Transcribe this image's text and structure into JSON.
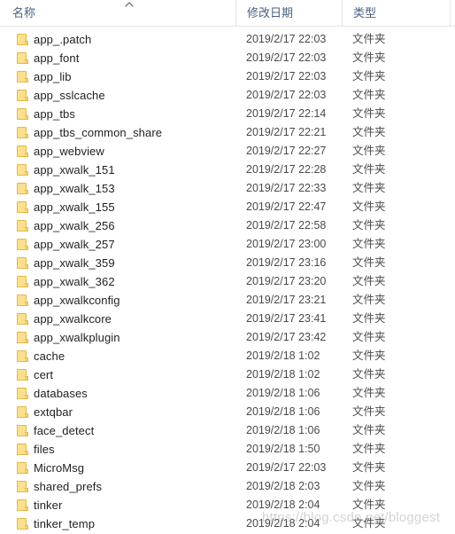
{
  "header": {
    "columns": [
      {
        "label": "名称",
        "name": "column-header-name"
      },
      {
        "label": "修改日期",
        "name": "column-header-date-modified"
      },
      {
        "label": "类型",
        "name": "column-header-type"
      }
    ],
    "sort_indicator": "chevron-up-icon"
  },
  "colors": {
    "header_text": "#4a6180",
    "row_text": "#1f1f1f",
    "meta_text": "#4a4a4a",
    "folder_fill": "#fbe08d",
    "folder_border": "#e3b94a",
    "divider": "#e3e3e3"
  },
  "rows": [
    {
      "icon": "folder-icon",
      "name": "app_.patch",
      "date": "2019/2/17 22:03",
      "type": "文件夹"
    },
    {
      "icon": "folder-icon",
      "name": "app_font",
      "date": "2019/2/17 22:03",
      "type": "文件夹"
    },
    {
      "icon": "folder-icon",
      "name": "app_lib",
      "date": "2019/2/17 22:03",
      "type": "文件夹"
    },
    {
      "icon": "folder-icon",
      "name": "app_sslcache",
      "date": "2019/2/17 22:03",
      "type": "文件夹"
    },
    {
      "icon": "folder-icon",
      "name": "app_tbs",
      "date": "2019/2/17 22:14",
      "type": "文件夹"
    },
    {
      "icon": "folder-icon",
      "name": "app_tbs_common_share",
      "date": "2019/2/17 22:21",
      "type": "文件夹"
    },
    {
      "icon": "folder-icon",
      "name": "app_webview",
      "date": "2019/2/17 22:27",
      "type": "文件夹"
    },
    {
      "icon": "folder-icon",
      "name": "app_xwalk_151",
      "date": "2019/2/17 22:28",
      "type": "文件夹"
    },
    {
      "icon": "folder-icon",
      "name": "app_xwalk_153",
      "date": "2019/2/17 22:33",
      "type": "文件夹"
    },
    {
      "icon": "folder-icon",
      "name": "app_xwalk_155",
      "date": "2019/2/17 22:47",
      "type": "文件夹"
    },
    {
      "icon": "folder-icon",
      "name": "app_xwalk_256",
      "date": "2019/2/17 22:58",
      "type": "文件夹"
    },
    {
      "icon": "folder-icon",
      "name": "app_xwalk_257",
      "date": "2019/2/17 23:00",
      "type": "文件夹"
    },
    {
      "icon": "folder-icon",
      "name": "app_xwalk_359",
      "date": "2019/2/17 23:16",
      "type": "文件夹"
    },
    {
      "icon": "folder-icon",
      "name": "app_xwalk_362",
      "date": "2019/2/17 23:20",
      "type": "文件夹"
    },
    {
      "icon": "folder-icon",
      "name": "app_xwalkconfig",
      "date": "2019/2/17 23:21",
      "type": "文件夹"
    },
    {
      "icon": "folder-icon",
      "name": "app_xwalkcore",
      "date": "2019/2/17 23:41",
      "type": "文件夹"
    },
    {
      "icon": "folder-icon",
      "name": "app_xwalkplugin",
      "date": "2019/2/17 23:42",
      "type": "文件夹"
    },
    {
      "icon": "folder-icon",
      "name": "cache",
      "date": "2019/2/18 1:02",
      "type": "文件夹"
    },
    {
      "icon": "folder-icon",
      "name": "cert",
      "date": "2019/2/18 1:02",
      "type": "文件夹"
    },
    {
      "icon": "folder-icon",
      "name": "databases",
      "date": "2019/2/18 1:06",
      "type": "文件夹"
    },
    {
      "icon": "folder-icon",
      "name": "extqbar",
      "date": "2019/2/18 1:06",
      "type": "文件夹"
    },
    {
      "icon": "folder-icon",
      "name": "face_detect",
      "date": "2019/2/18 1:06",
      "type": "文件夹"
    },
    {
      "icon": "folder-icon",
      "name": "files",
      "date": "2019/2/18 1:50",
      "type": "文件夹"
    },
    {
      "icon": "folder-icon",
      "name": "MicroMsg",
      "date": "2019/2/17 22:03",
      "type": "文件夹"
    },
    {
      "icon": "folder-icon",
      "name": "shared_prefs",
      "date": "2019/2/18 2:03",
      "type": "文件夹"
    },
    {
      "icon": "folder-icon",
      "name": "tinker",
      "date": "2019/2/18 2:04",
      "type": "文件夹"
    },
    {
      "icon": "folder-icon",
      "name": "tinker_temp",
      "date": "2019/2/18 2:04",
      "type": "文件夹"
    }
  ],
  "watermark": {
    "text": "https://blog.csdn.net/bloggest"
  }
}
